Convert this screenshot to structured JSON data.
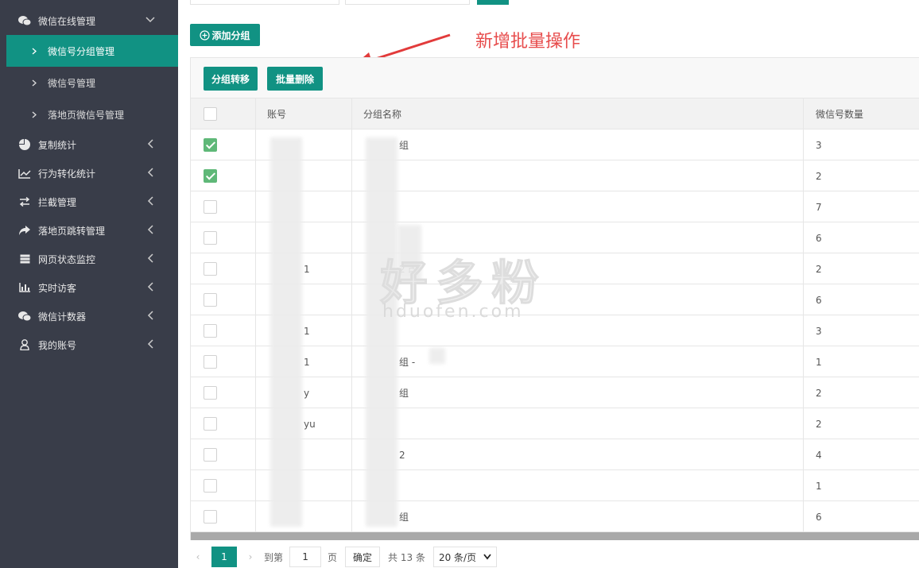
{
  "sidebar": {
    "group_title": "微信在线管理",
    "sub_items": [
      "微信号分组管理",
      "微信号管理",
      "落地页微信号管理"
    ],
    "items": [
      {
        "label": "复制统计",
        "icon": "pie-chart-icon"
      },
      {
        "label": "行为转化统计",
        "icon": "line-chart-icon"
      },
      {
        "label": "拦截管理",
        "icon": "swap-arrows-icon"
      },
      {
        "label": "落地页跳转管理",
        "icon": "share-arrow-icon"
      },
      {
        "label": "网页状态监控",
        "icon": "server-icon"
      },
      {
        "label": "实时访客",
        "icon": "bar-chart-icon"
      },
      {
        "label": "微信计数器",
        "icon": "wechat-icon"
      },
      {
        "label": "我的账号",
        "icon": "user-icon"
      }
    ]
  },
  "toolbar": {
    "add_group": "添加分组",
    "move_group": "分组转移",
    "batch_delete": "批量删除"
  },
  "annotation": {
    "text": "新增批量操作"
  },
  "table": {
    "columns": [
      "账号",
      "分组名称",
      "微信号数量"
    ],
    "rows": [
      {
        "checked": true,
        "account": "",
        "group": "组",
        "count": "3"
      },
      {
        "checked": true,
        "account": "",
        "group": "",
        "count": "2"
      },
      {
        "checked": false,
        "account": "",
        "group": "",
        "count": "7"
      },
      {
        "checked": false,
        "account": "",
        "group": "",
        "count": "6"
      },
      {
        "checked": false,
        "account": "1",
        "group": "2 改",
        "count": "2"
      },
      {
        "checked": false,
        "account": "",
        "group": "",
        "count": "6"
      },
      {
        "checked": false,
        "account": "1",
        "group": "",
        "count": "3"
      },
      {
        "checked": false,
        "account": "1",
        "group": "组 -",
        "count": "1"
      },
      {
        "checked": false,
        "account": "y",
        "group": "组",
        "count": "2"
      },
      {
        "checked": false,
        "account": "yu",
        "group": "",
        "count": "2"
      },
      {
        "checked": false,
        "account": "",
        "group": "2",
        "count": "4"
      },
      {
        "checked": false,
        "account": "",
        "group": "",
        "count": "1"
      },
      {
        "checked": false,
        "account": "",
        "group": "组",
        "count": "6"
      }
    ]
  },
  "watermark": {
    "brand": "好多粉",
    "domain": "hduofen.com"
  },
  "pager": {
    "current": "1",
    "goto_label": "到第",
    "goto_value": "1",
    "page_label": "页",
    "confirm": "确定",
    "total": "共 13 条",
    "page_size": "20 条/页"
  }
}
